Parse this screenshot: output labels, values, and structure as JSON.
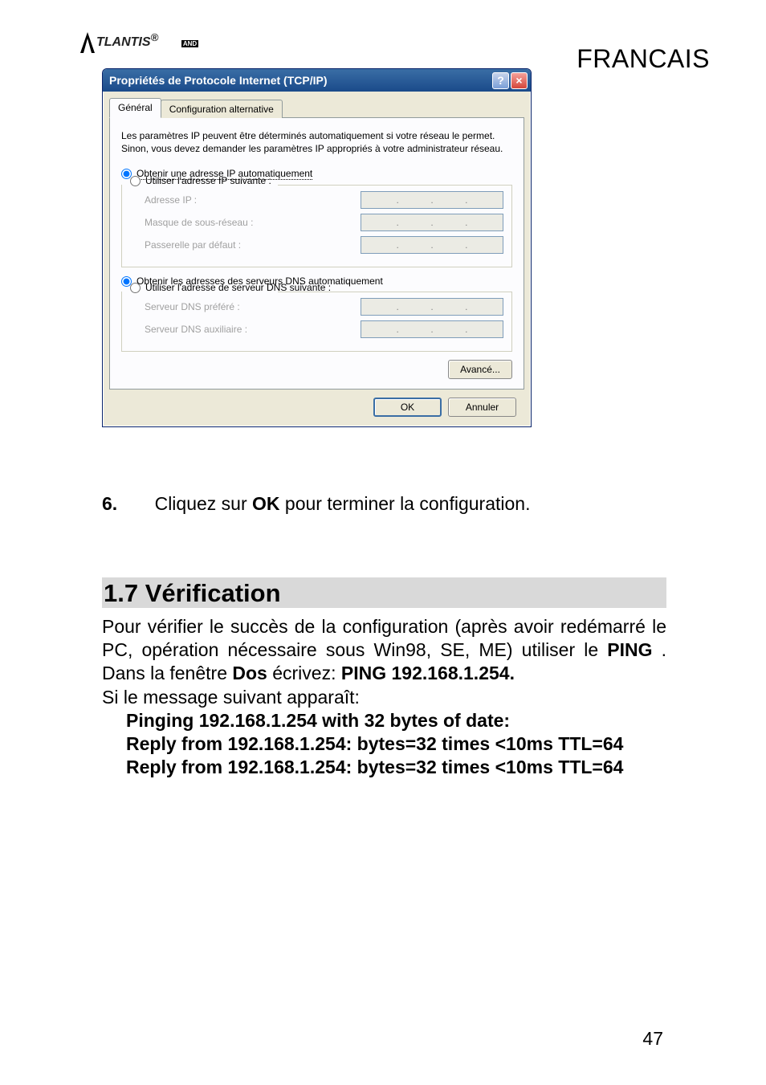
{
  "header": {
    "brand": "TLANTIS",
    "brand_sub": "AND",
    "language": "FRANCAIS"
  },
  "dialog": {
    "title": "Propriétés de Protocole Internet (TCP/IP)",
    "tabs": {
      "general": "Général",
      "alternative": "Configuration alternative"
    },
    "info": "Les paramètres IP peuvent être déterminés automatiquement si votre réseau le permet. Sinon, vous devez demander les paramètres IP appropriés à votre administrateur réseau.",
    "radio_ip_auto": "Obtenir une adresse IP automatiquement",
    "radio_ip_manual": "Utiliser l'adresse IP suivante :",
    "field_ip": "Adresse IP :",
    "field_mask": "Masque de sous-réseau :",
    "field_gateway": "Passerelle par défaut :",
    "radio_dns_auto": "Obtenir les adresses des serveurs DNS automatiquement",
    "radio_dns_manual": "Utiliser l'adresse de serveur DNS suivante :",
    "field_dns_pref": "Serveur DNS préféré :",
    "field_dns_aux": "Serveur DNS auxiliaire :",
    "btn_advanced": "Avancé...",
    "btn_ok": "OK",
    "btn_cancel": "Annuler"
  },
  "step6": {
    "num": "6.",
    "pre": "Cliquez sur  ",
    "ok": "OK",
    "post": " pour terminer la configuration."
  },
  "section": {
    "title": "1.7 Vérification"
  },
  "body": {
    "p1a": "Pour vérifier le succès de la configuration (après avoir redémarré le PC, opération nécessaire sous Win98, SE, ME) utiliser le ",
    "ping": "PING",
    "p1b": ". Dans la fenêtre ",
    "dos": "Dos",
    "p1c": " écrivez: ",
    "pingcmd": "PING 192.168.1.254.",
    "p2": "Si le message suivant apparaît:",
    "l1": "Pinging 192.168.1.254 with 32 bytes of date:",
    "l2": "Reply from 192.168.1.254: bytes=32 times <10ms TTL=64",
    "l3": "Reply from 192.168.1.254: bytes=32 times <10ms TTL=64"
  },
  "page_number": "47"
}
